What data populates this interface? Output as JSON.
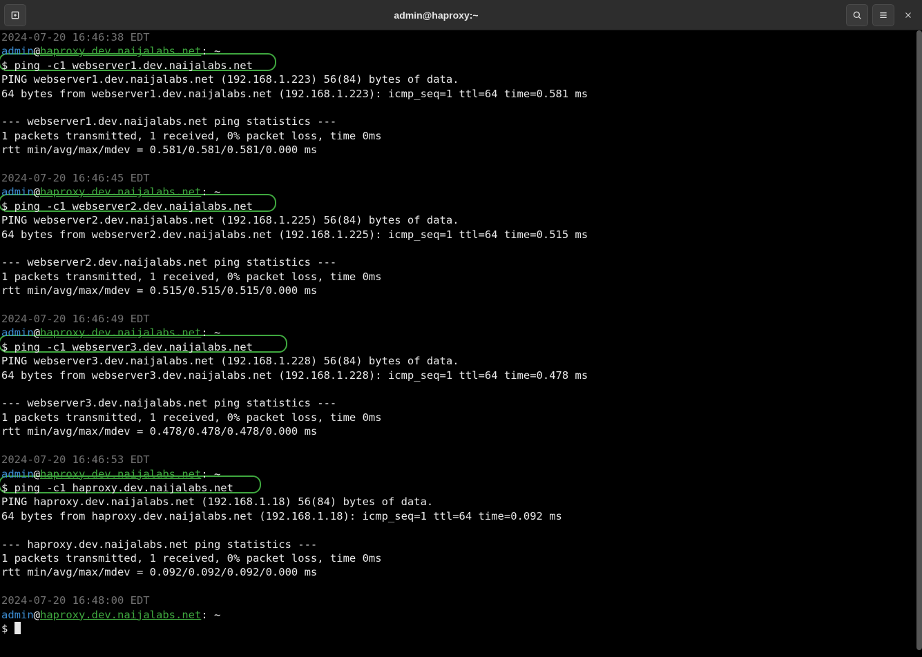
{
  "window": {
    "title": "admin@haproxy:~"
  },
  "prompt": {
    "user": "admin",
    "at": "@",
    "host": "haproxy.dev.naijalabs.net",
    "path_sep": ": ",
    "path": "~",
    "symbol": "$ "
  },
  "blocks": [
    {
      "timestamp": "2024-07-20 16:46:38 EDT",
      "command": "ping -c1 webserver1.dev.naijalabs.net",
      "hl_width": 402,
      "output": [
        "PING webserver1.dev.naijalabs.net (192.168.1.223) 56(84) bytes of data.",
        "64 bytes from webserver1.dev.naijalabs.net (192.168.1.223): icmp_seq=1 ttl=64 time=0.581 ms",
        "",
        "--- webserver1.dev.naijalabs.net ping statistics ---",
        "1 packets transmitted, 1 received, 0% packet loss, time 0ms",
        "rtt min/avg/max/mdev = 0.581/0.581/0.581/0.000 ms"
      ]
    },
    {
      "timestamp": "2024-07-20 16:46:45 EDT",
      "command": "ping -c1 webserver2.dev.naijalabs.net",
      "hl_width": 402,
      "output": [
        "PING webserver2.dev.naijalabs.net (192.168.1.225) 56(84) bytes of data.",
        "64 bytes from webserver2.dev.naijalabs.net (192.168.1.225): icmp_seq=1 ttl=64 time=0.515 ms",
        "",
        "--- webserver2.dev.naijalabs.net ping statistics ---",
        "1 packets transmitted, 1 received, 0% packet loss, time 0ms",
        "rtt min/avg/max/mdev = 0.515/0.515/0.515/0.000 ms"
      ]
    },
    {
      "timestamp": "2024-07-20 16:46:49 EDT",
      "command": "ping -c1 webserver3.dev.naijalabs.net",
      "hl_width": 418,
      "output": [
        "PING webserver3.dev.naijalabs.net (192.168.1.228) 56(84) bytes of data.",
        "64 bytes from webserver3.dev.naijalabs.net (192.168.1.228): icmp_seq=1 ttl=64 time=0.478 ms",
        "",
        "--- webserver3.dev.naijalabs.net ping statistics ---",
        "1 packets transmitted, 1 received, 0% packet loss, time 0ms",
        "rtt min/avg/max/mdev = 0.478/0.478/0.478/0.000 ms"
      ]
    },
    {
      "timestamp": "2024-07-20 16:46:53 EDT",
      "command": "ping -c1 haproxy.dev.naijalabs.net",
      "hl_width": 380,
      "output": [
        "PING haproxy.dev.naijalabs.net (192.168.1.18) 56(84) bytes of data.",
        "64 bytes from haproxy.dev.naijalabs.net (192.168.1.18): icmp_seq=1 ttl=64 time=0.092 ms",
        "",
        "--- haproxy.dev.naijalabs.net ping statistics ---",
        "1 packets transmitted, 1 received, 0% packet loss, time 0ms",
        "rtt min/avg/max/mdev = 0.092/0.092/0.092/0.000 ms"
      ]
    }
  ],
  "final": {
    "timestamp": "2024-07-20 16:48:00 EDT"
  }
}
